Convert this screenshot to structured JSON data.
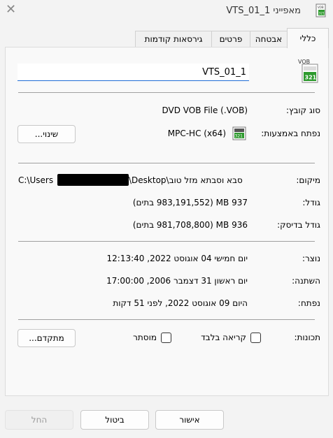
{
  "window": {
    "title": "מאפייני VTS_01_1",
    "close_glyph": "✕"
  },
  "tabs": [
    {
      "label": "כללי",
      "active": true
    },
    {
      "label": "אבטחה",
      "active": false
    },
    {
      "label": "פרטים",
      "active": false
    },
    {
      "label": "גירסאות קודמות",
      "active": false
    }
  ],
  "general": {
    "file_name": "VTS_01_1",
    "file_type_label": "סוג קובץ:",
    "file_type_value": "DVD VOB File (.VOB)",
    "opens_with_label": "נפתח באמצעות:",
    "opens_with_value": "MPC-HC (x64)",
    "change_button": "שינוי...",
    "location_label": "מיקום:",
    "location_prefix": "C:\\Users",
    "location_suffix": "\\Desktop\\סבא וסבתא מזל טוב",
    "size_label": "גודל:",
    "size_value": "937 MB (983,191,552 בתים)",
    "size_on_disk_label": "גודל בדיסק:",
    "size_on_disk_value": "936 MB (981,708,800 בתים)",
    "created_label": "נוצר:",
    "created_value": "יום חמישי 04 אוגוסט 2022, 12:13:40",
    "modified_label": "השתנה:",
    "modified_value": "יום ראשון 31 דצמבר 2006, 17:00:00",
    "accessed_label": "נפתח:",
    "accessed_value": "היום 09 אוגוסט 2022, לפני 51 דקות",
    "attributes_label": "תכונות:",
    "readonly_label": "קריאה בלבד",
    "readonly_checked": false,
    "hidden_label": "מוסתר",
    "hidden_checked": false,
    "advanced_button": "מתקדם..."
  },
  "footer": {
    "ok": "אישור",
    "cancel": "ביטול",
    "apply": "החל"
  },
  "icons": {
    "file_icon": "vob-file-icon",
    "app_icon": "mpc-hc-icon",
    "icon_badge": "321",
    "icon_ext": "VOB"
  },
  "colors": {
    "accent_blue": "#1f6cd6",
    "icon_green": "#2e9a2e"
  }
}
